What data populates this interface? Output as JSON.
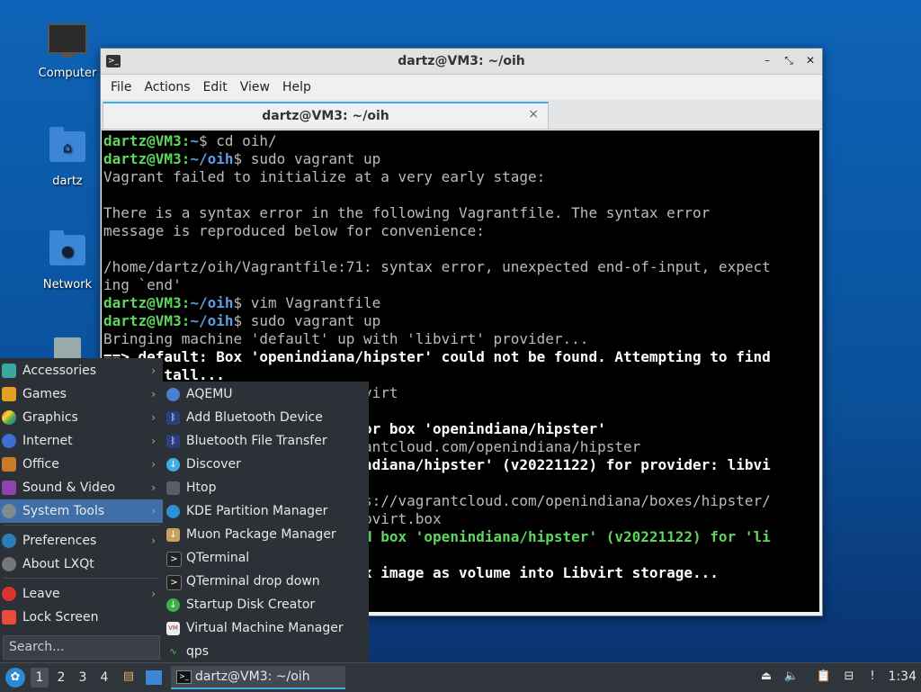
{
  "desktop": {
    "icons": [
      {
        "label": "Computer"
      },
      {
        "label": "dartz"
      },
      {
        "label": "Network"
      },
      {
        "label": ""
      }
    ]
  },
  "window": {
    "title": "dartz@VM3: ~/oih",
    "menu": [
      "File",
      "Actions",
      "Edit",
      "View",
      "Help"
    ],
    "tab_title": "dartz@VM3: ~/oih",
    "close_glyph": "×"
  },
  "terminal": {
    "lines": [
      {
        "prompt_user": "dartz@VM3",
        "prompt_path": "~",
        "cmd": "$ cd oih/"
      },
      {
        "prompt_user": "dartz@VM3",
        "prompt_path": "~/oih",
        "cmd": "$ sudo vagrant up"
      },
      {
        "text": "Vagrant failed to initialize at a very early stage:"
      },
      {
        "text": ""
      },
      {
        "text": "There is a syntax error in the following Vagrantfile. The syntax error"
      },
      {
        "text": "message is reproduced below for convenience:"
      },
      {
        "text": ""
      },
      {
        "text": "/home/dartz/oih/Vagrantfile:71: syntax error, unexpected end-of-input, expect"
      },
      {
        "text": "ing `end'"
      },
      {
        "prompt_user": "dartz@VM3",
        "prompt_path": "~/oih",
        "cmd": "$ vim Vagrantfile"
      },
      {
        "prompt_user": "dartz@VM3",
        "prompt_path": "~/oih",
        "cmd": "$ sudo vagrant up"
      },
      {
        "text": "Bringing machine 'default' up with 'libvirt' provider..."
      },
      {
        "bold": "==> default: Box 'openindiana/hipster' could not be found. Attempting to find"
      },
      {
        "bold": "    install..."
      },
      {
        "text": "                             ovirt"
      },
      {
        "text": "                             )"
      },
      {
        "bold": "                             for box 'openindiana/hipster'"
      },
      {
        "text": "                             rantcloud.com/openindiana/hipster"
      },
      {
        "bold": "                             indiana/hipster' (v20221122) for provider: libvi"
      },
      {
        "text": ""
      },
      {
        "text": "                             ps://vagrantcloud.com/openindiana/boxes/hipster/"
      },
      {
        "text": "                             ibvirt.box"
      },
      {
        "green": "                             ed box 'openindiana/hipster' (v20221122) for 'li"
      },
      {
        "text": ""
      },
      {
        "bold": "                             ox image as volume into Libvirt storage..."
      }
    ]
  },
  "start_menu": {
    "items": [
      {
        "label": "Accessories",
        "arrow": "›"
      },
      {
        "label": "Games",
        "arrow": "›"
      },
      {
        "label": "Graphics",
        "arrow": "›"
      },
      {
        "label": "Internet",
        "arrow": "›"
      },
      {
        "label": "Office",
        "arrow": "›"
      },
      {
        "label": "Sound & Video",
        "arrow": "›"
      },
      {
        "label": "System Tools",
        "arrow": "›"
      },
      {
        "label": "Preferences",
        "arrow": "›"
      },
      {
        "label": "About LXQt",
        "arrow": ""
      },
      {
        "label": "Leave",
        "arrow": "›"
      },
      {
        "label": "Lock Screen",
        "arrow": ""
      }
    ],
    "search_placeholder": "Search...",
    "submenu": [
      {
        "label": "AQEMU"
      },
      {
        "label": "Add Bluetooth Device"
      },
      {
        "label": "Bluetooth File Transfer"
      },
      {
        "label": "Discover"
      },
      {
        "label": "Htop"
      },
      {
        "label": "KDE Partition Manager"
      },
      {
        "label": "Muon Package Manager"
      },
      {
        "label": "QTerminal"
      },
      {
        "label": "QTerminal drop down"
      },
      {
        "label": "Startup Disk Creator"
      },
      {
        "label": "Virtual Machine Manager"
      },
      {
        "label": "qps"
      }
    ]
  },
  "taskbar": {
    "workspaces": [
      "1",
      "2",
      "3",
      "4"
    ],
    "active_app": "dartz@VM3: ~/oih",
    "clock": "1:34"
  }
}
